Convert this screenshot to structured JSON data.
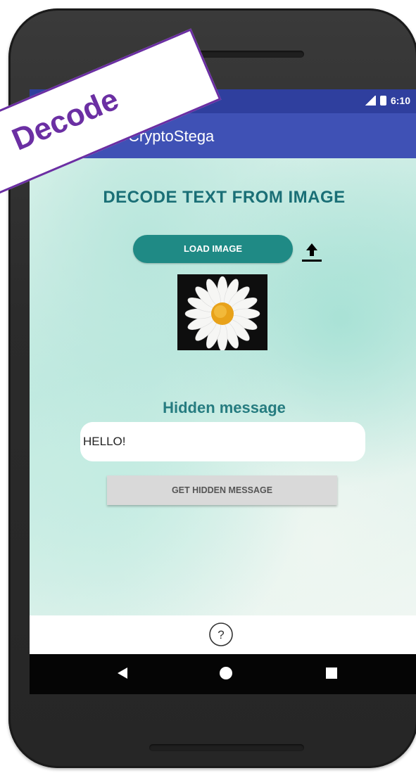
{
  "banner": {
    "text": "Decode",
    "color": "#6b2fa3"
  },
  "status_bar": {
    "time": "6:10",
    "icons": [
      "signal-icon",
      "battery-icon"
    ]
  },
  "app_bar": {
    "title": "CryptoStega",
    "color": "#3f51b5"
  },
  "main": {
    "heading": "DECODE TEXT FROM IMAGE",
    "load_button_label": "LOAD IMAGE",
    "upload_icon": "upload-arrow-icon",
    "image": "daisy-flower-image",
    "hidden_label": "Hidden message",
    "message_value": "HELLO!",
    "get_button_label": "GET HIDDEN MESSAGE",
    "accent_color": "#1f8a85"
  },
  "help_icon": "help-icon",
  "nav_bar": {
    "icons": [
      "nav-back-icon",
      "nav-home-icon",
      "nav-recents-icon"
    ]
  }
}
